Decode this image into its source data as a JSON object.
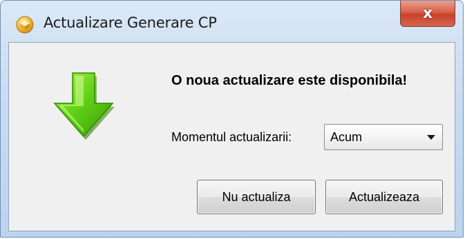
{
  "window": {
    "title": "Actualizare Generare CP",
    "close_label": "x"
  },
  "dialog": {
    "headline": "O noua actualizare este disponibila!",
    "moment_label": "Momentul actualizarii:",
    "moment_selected": "Acum",
    "buttons": {
      "no_update": "Nu actualiza",
      "update": "Actualizeaza"
    }
  },
  "icons": {
    "app": "package-box-icon",
    "arrow": "green-down-arrow-icon",
    "dropdown": "chevron-down-icon"
  },
  "colors": {
    "arrow_green": "#5fd10f",
    "arrow_dark": "#3b8f06",
    "close_red": "#c7402a",
    "titlebar_blue": "#c9dcf1"
  }
}
